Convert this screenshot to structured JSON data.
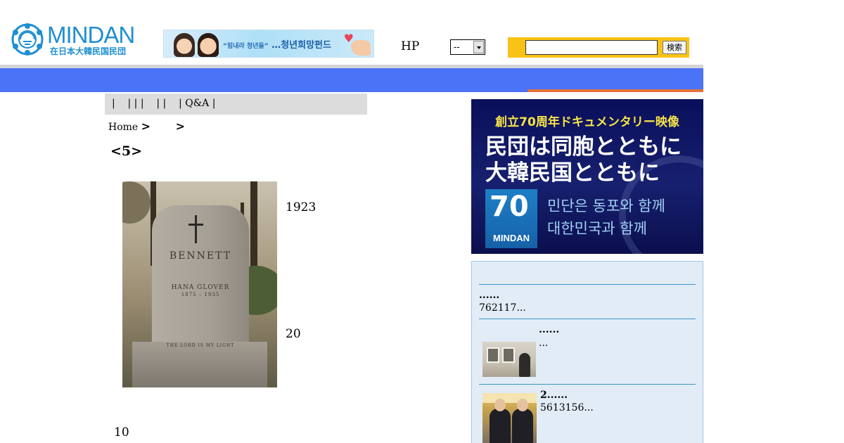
{
  "header": {
    "logo_main": "MINDAN",
    "logo_sub": "在日本大韓民国民団",
    "banner_small": "“힘내라 청년들”",
    "banner_text": "…청년희망펀드",
    "hp_label": "HP",
    "select_value": "--",
    "search_value": "",
    "search_button": "検索"
  },
  "colors": {
    "nav_bar": "#4a73f7",
    "nav_accent": "#e8723c",
    "search_bg": "#f9c316",
    "logo": "#1f8fd1",
    "sidebar_bg": "#e2ecf7"
  },
  "subnav": {
    "text": "|    | | |    | |    | Q&A |"
  },
  "breadcrumb": {
    "home": "Home",
    "sep1": ">",
    "sep2": ">"
  },
  "article": {
    "title": "<5>",
    "year": "1923",
    "num1": "20",
    "num2": "10",
    "photo_engraving": {
      "name": "BENNETT",
      "line1": "HANA GLOVER",
      "line2": "1875 – 1935",
      "epitaph": "THE LORD IS MY LIGHT"
    }
  },
  "promo": {
    "top_line": "創立70周年ドキュメンタリー映像",
    "main_line1": "民団は同胞とともに",
    "main_line2": "大韓民国とともに",
    "badge_number": "70",
    "badge_label": "MINDAN",
    "korean_line1": "민단은 동포와 함께",
    "korean_line2": "대한민국과 함께"
  },
  "news": {
    "items": [
      {
        "title": "......",
        "sub": "762117..."
      },
      {
        "title": "......",
        "sub": "..."
      },
      {
        "title": "2......",
        "sub": "5613156..."
      }
    ]
  },
  "icons": {
    "emblem": "mindan-emblem-icon",
    "select_arrow": "chevron-down-icon"
  }
}
